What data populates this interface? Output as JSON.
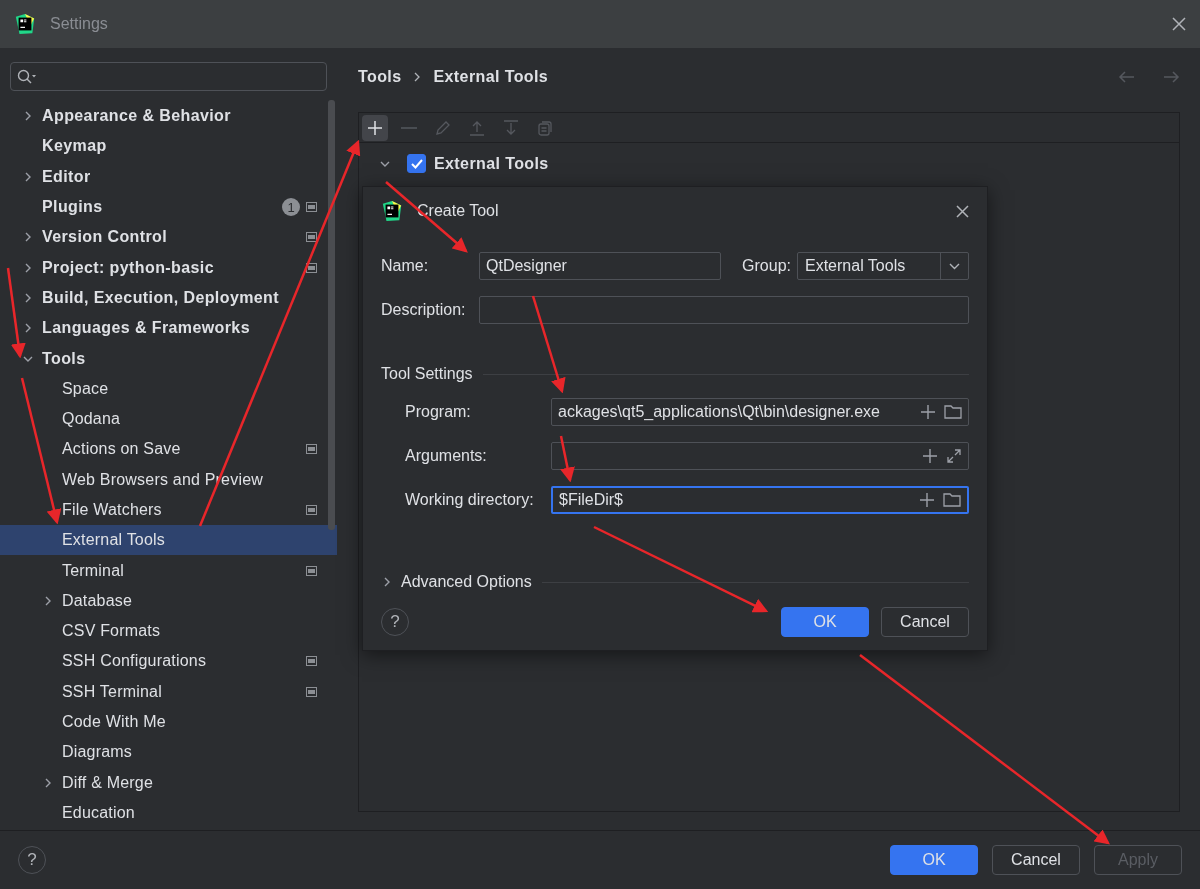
{
  "window": {
    "title": "Settings"
  },
  "sidebar": {
    "items": [
      {
        "label": "Appearance & Behavior",
        "kind": "group",
        "expanded": false,
        "selected": false,
        "shared": false
      },
      {
        "label": "Keymap",
        "kind": "page",
        "selected": false,
        "shared": false
      },
      {
        "label": "Editor",
        "kind": "group",
        "expanded": false,
        "selected": false,
        "shared": false
      },
      {
        "label": "Plugins",
        "kind": "page",
        "selected": false,
        "shared": true,
        "badge": "1"
      },
      {
        "label": "Version Control",
        "kind": "group",
        "expanded": false,
        "selected": false,
        "shared": true
      },
      {
        "label": "Project: python-basic",
        "kind": "group",
        "expanded": false,
        "selected": false,
        "shared": true
      },
      {
        "label": "Build, Execution, Deployment",
        "kind": "group",
        "expanded": false,
        "selected": false,
        "shared": false
      },
      {
        "label": "Languages & Frameworks",
        "kind": "group",
        "expanded": false,
        "selected": false,
        "shared": false
      },
      {
        "label": "Tools",
        "kind": "group",
        "expanded": true,
        "selected": false,
        "shared": false,
        "children": [
          {
            "label": "Space",
            "kind": "page",
            "selected": false,
            "shared": false
          },
          {
            "label": "Qodana",
            "kind": "page",
            "selected": false,
            "shared": false
          },
          {
            "label": "Actions on Save",
            "kind": "page",
            "selected": false,
            "shared": true
          },
          {
            "label": "Web Browsers and Preview",
            "kind": "page",
            "selected": false,
            "shared": false
          },
          {
            "label": "File Watchers",
            "kind": "page",
            "selected": false,
            "shared": true
          },
          {
            "label": "External Tools",
            "kind": "page",
            "selected": true,
            "shared": false
          },
          {
            "label": "Terminal",
            "kind": "page",
            "selected": false,
            "shared": true
          },
          {
            "label": "Database",
            "kind": "group",
            "expanded": false,
            "selected": false,
            "shared": false
          },
          {
            "label": "CSV Formats",
            "kind": "page",
            "selected": false,
            "shared": false
          },
          {
            "label": "SSH Configurations",
            "kind": "page",
            "selected": false,
            "shared": true
          },
          {
            "label": "SSH Terminal",
            "kind": "page",
            "selected": false,
            "shared": true
          },
          {
            "label": "Code With Me",
            "kind": "page",
            "selected": false,
            "shared": false
          },
          {
            "label": "Diagrams",
            "kind": "page",
            "selected": false,
            "shared": false
          },
          {
            "label": "Diff & Merge",
            "kind": "group",
            "expanded": false,
            "selected": false,
            "shared": false
          },
          {
            "label": "Education",
            "kind": "page",
            "selected": false,
            "shared": false
          }
        ]
      }
    ]
  },
  "breadcrumb": [
    "Tools",
    "External Tools"
  ],
  "tool_tree": {
    "label": "External Tools",
    "checked": true,
    "expanded": true
  },
  "dialog": {
    "title": "Create Tool",
    "help": "?",
    "name": {
      "label": "Name:",
      "value": "QtDesigner"
    },
    "group": {
      "label": "Group:",
      "value": "External Tools"
    },
    "description": {
      "label": "Description:"
    },
    "section": "Tool Settings",
    "settings": [
      {
        "label": "Program:",
        "value": "ackages\\qt5_applications\\Qt\\bin\\designer.exe",
        "kind": "browse",
        "focused": false
      },
      {
        "label": "Arguments:",
        "kind": "expand",
        "focused": false
      },
      {
        "label": "Working directory:",
        "value": "$FileDir$",
        "kind": "browse",
        "focused": true
      }
    ],
    "advanced": {
      "label": "Advanced Options",
      "expanded": false
    },
    "buttons": [
      {
        "label": "OK",
        "primary": true
      },
      {
        "label": "Cancel",
        "primary": false
      }
    ]
  },
  "footer": {
    "help": "?",
    "buttons": [
      {
        "label": "OK",
        "primary": true,
        "disabled": false
      },
      {
        "label": "Cancel",
        "primary": false,
        "disabled": false
      },
      {
        "label": "Apply",
        "primary": false,
        "disabled": true
      }
    ]
  }
}
